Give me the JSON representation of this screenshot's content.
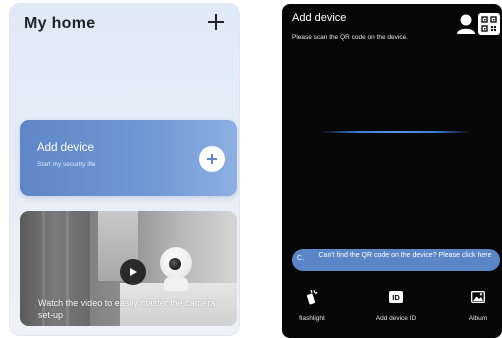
{
  "home": {
    "title": "My home",
    "add_icon": "plus-icon",
    "add_device_card": {
      "title": "Add device",
      "subtitle": "Start my security life",
      "action_icon": "plus-circle-icon"
    },
    "video_card": {
      "caption": "Watch the video to easily master the camera set-up",
      "play_icon": "play-icon"
    }
  },
  "scan": {
    "title": "Add device",
    "subtitle": "Please scan the QR code on the device.",
    "top_icons": [
      "person-icon",
      "qr-code-icon"
    ],
    "hint": {
      "prefix": "C.",
      "text": "Can't find the QR code on the device? Please click here"
    },
    "bottom_bar": {
      "flashlight": {
        "label": "flashlight",
        "icon": "flashlight-icon"
      },
      "device_id": {
        "label": "Add device ID",
        "icon": "id-icon"
      },
      "album": {
        "label": "Album",
        "icon": "album-icon"
      }
    }
  },
  "colors": {
    "card_blue": "#5f86c6",
    "scan_line": "#3f7ddc",
    "hint_pill": "#5a86c7",
    "scan_background": "#060606"
  }
}
